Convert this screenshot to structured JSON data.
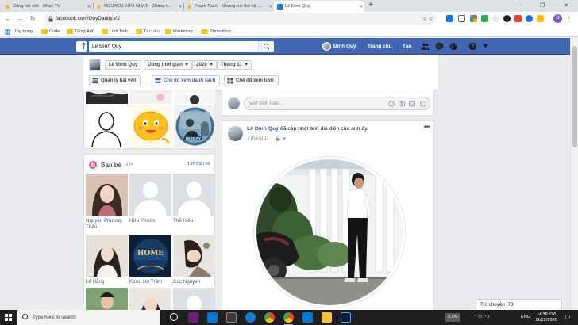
{
  "browser": {
    "tabs": [
      {
        "title": "Đăng bài viết - Ohay TV",
        "favicon": "star-icon"
      },
      {
        "title": "NGUYỄN HỮU NHẤT - Chàng tr...",
        "favicon": "star-icon"
      },
      {
        "title": "Phạm Tuấn – Chàng trai thế hệ ...",
        "favicon": "star-icon"
      },
      {
        "title": "Lê Đình Quý",
        "favicon": "facebook-icon",
        "active": true
      }
    ],
    "url": "facebook.com/QuyDaddy.V2",
    "profile_initial": "D",
    "bookmarks": [
      "Ứng dụng",
      "Code",
      "Tiếng Anh",
      "Linh Tinh",
      "Tài Liệu",
      "Marketing",
      "Photoshop"
    ]
  },
  "fb_header": {
    "search_value": "Lê Đình Quý",
    "user_name": "Đình Quý",
    "home_label": "Trang chủ",
    "create_label": "Tạo"
  },
  "timeline_bar": {
    "name": "Lê Đình Quý",
    "timeline_label": "Dòng thời gian",
    "year": "2020",
    "month": "Tháng 11",
    "manage_posts": "Quản lý bài viết",
    "list_view": "Chế độ xem danh sách",
    "grid_view": "Chế độ xem lưới"
  },
  "friends": {
    "title": "Bạn bè",
    "count": "435",
    "find_link": "Tìm bạn bè",
    "items": [
      {
        "name": "Nguyễn Phương Thảo"
      },
      {
        "name": "Hữu Phước"
      },
      {
        "name": "Thế Hiếu"
      },
      {
        "name": "Lê Hằng"
      },
      {
        "name": "Kσσn Hờ Trâm"
      },
      {
        "name": "Cúc Nguyen"
      }
    ]
  },
  "photo_badge": "MISDAY",
  "game_text": "HOME",
  "comment_box": {
    "placeholder": "Viết bình luận..."
  },
  "post": {
    "author": "Lê Đình Quý",
    "action": "đã cập nhật ảnh đại diện của anh ấy.",
    "date": "7 tháng 11"
  },
  "chat": {
    "label": "Trò chuyện (73)"
  },
  "taskbar": {
    "search_placeholder": "Type here to search",
    "battery": "5.5%",
    "language": "ENG",
    "time": "11:48 PM",
    "date": "11/22/2020"
  },
  "colors": {
    "fb_blue": "#4267b2",
    "link": "#365899",
    "friends_icon": "#f5417c"
  }
}
